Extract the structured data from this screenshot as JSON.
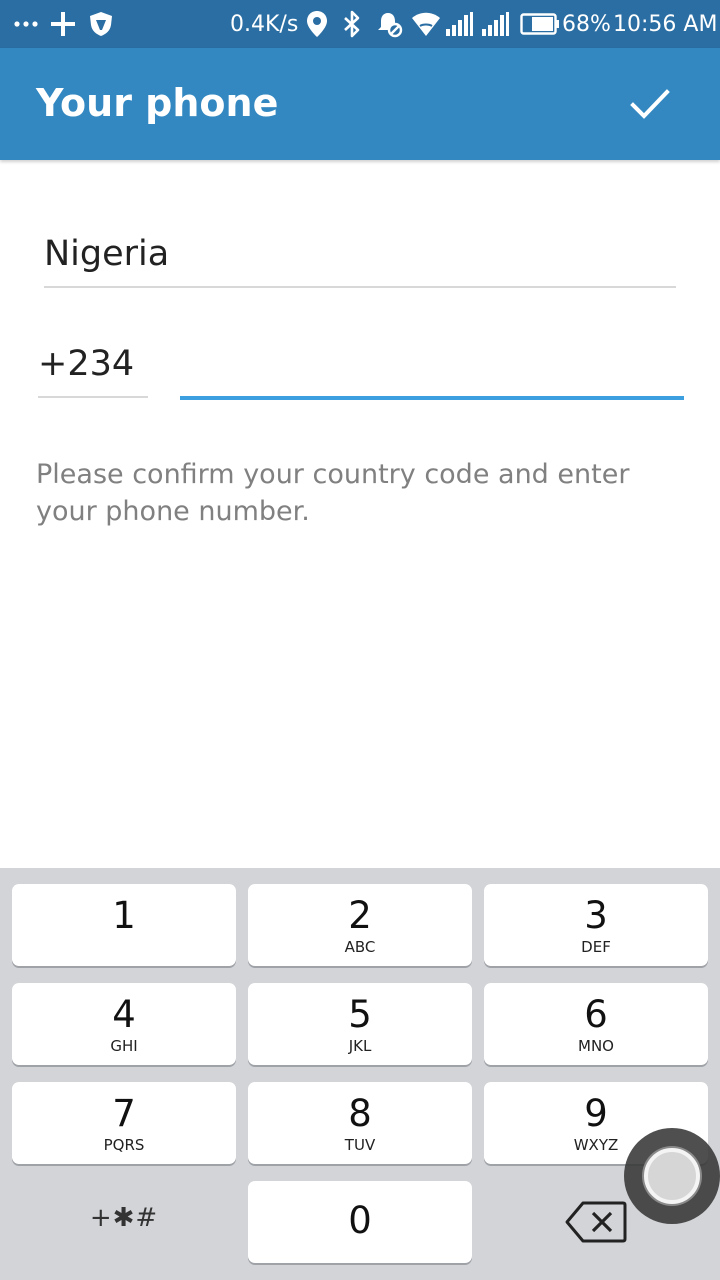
{
  "status_bar": {
    "more_icon": "more-dots",
    "add_icon": "plus",
    "shield_icon": "shield",
    "network_speed": "0.4K/s",
    "location_icon": "location-pin",
    "bluetooth_icon": "bluetooth",
    "alarm_icon": "alarm-off",
    "wifi_icon": "wifi",
    "signal_icons": [
      "signal-1",
      "signal-2"
    ],
    "battery_icon": "battery",
    "battery": "68%",
    "time": "10:56 AM",
    "background_color": "#2a6ea3"
  },
  "app_bar": {
    "title": "Your phone",
    "done_icon": "check",
    "background_color": "#3388c1"
  },
  "form": {
    "country": "Nigeria",
    "country_code": "+234",
    "phone_number": "",
    "active_field_color": "#3c9fe0",
    "hint": "Please confirm your country code and enter your phone number."
  },
  "keypad": {
    "background_color": "#d2d4d8",
    "keys": [
      {
        "digit": "1",
        "letters": ""
      },
      {
        "digit": "2",
        "letters": "ABC"
      },
      {
        "digit": "3",
        "letters": "DEF"
      },
      {
        "digit": "4",
        "letters": "GHI"
      },
      {
        "digit": "5",
        "letters": "JKL"
      },
      {
        "digit": "6",
        "letters": "MNO"
      },
      {
        "digit": "7",
        "letters": "PQRS"
      },
      {
        "digit": "8",
        "letters": "TUV"
      },
      {
        "digit": "9",
        "letters": "WXYZ"
      }
    ],
    "symbols": "+✱#",
    "zero": "0",
    "delete_icon": "backspace"
  },
  "assistive_touch_icon": "assistive-touch"
}
